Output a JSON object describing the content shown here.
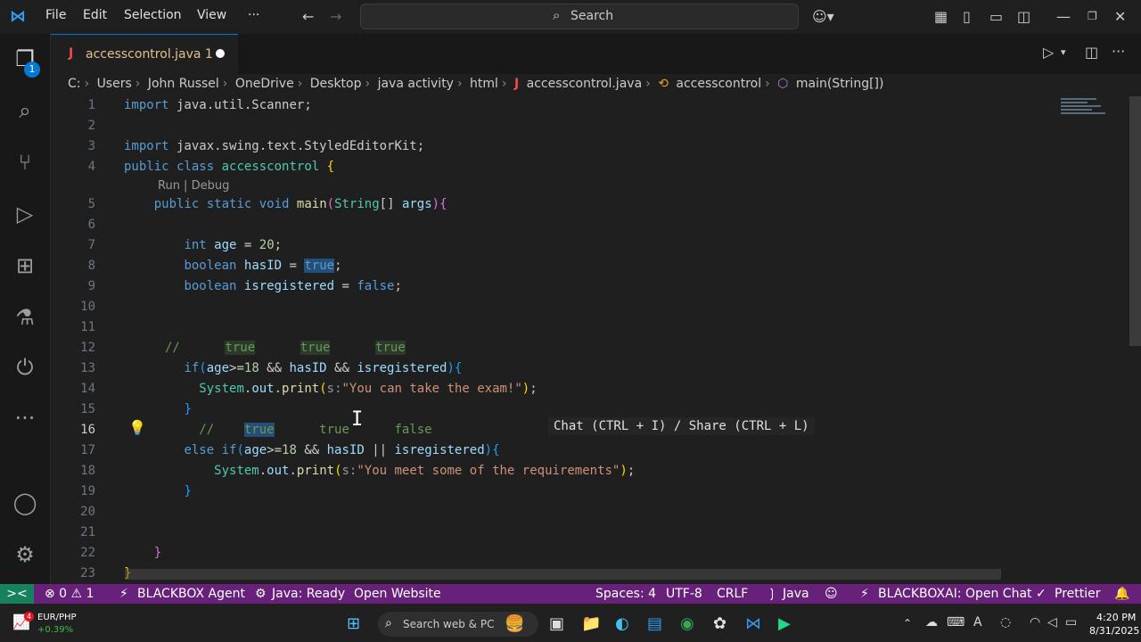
{
  "menu": [
    "File",
    "Edit",
    "Selection",
    "View",
    "···"
  ],
  "search": {
    "label": "Search"
  },
  "activity": {
    "badge": "1"
  },
  "tab": {
    "label": "accesscontrol.java 1",
    "icon": "J"
  },
  "breadcrumb": [
    "C:",
    "Users",
    "John Russel",
    "OneDrive",
    "Desktop",
    "java activity",
    "html",
    "accesscontrol.java",
    "accesscontrol",
    "main(String[])"
  ],
  "editor": {
    "line_numbers": [
      "1",
      "2",
      "3",
      "4",
      "5",
      "6",
      "7",
      "8",
      "9",
      "10",
      "11",
      "12",
      "13",
      "14",
      "15",
      "16",
      "17",
      "18",
      "19",
      "20",
      "21",
      "22",
      "23"
    ],
    "codelens": "Run | Debug",
    "tooltip": "Chat (CTRL + I) / Share (CTRL + L)"
  },
  "status": {
    "remote": "><",
    "problems": "⊗ 0 ⚠ 1",
    "blackbox_agent": "BLACKBOX Agent",
    "java_ready": "Java: Ready",
    "open_website": "Open Website",
    "spaces": "Spaces: 4",
    "encoding": "UTF-8",
    "eol": "CRLF",
    "language": "Java",
    "blackboxai": "BLACKBOXAI: Open Chat",
    "prettier": "Prettier"
  },
  "taskbar": {
    "currency": "EUR/PHP",
    "currency_change": "+0.39%",
    "currency_badge": "4",
    "search_placeholder": "Search web & PC",
    "time": "4:20 PM",
    "date": "8/31/2025"
  },
  "colors": {
    "statusbar": "#68217a",
    "accent": "#0078d4",
    "remote": "#16825d"
  }
}
